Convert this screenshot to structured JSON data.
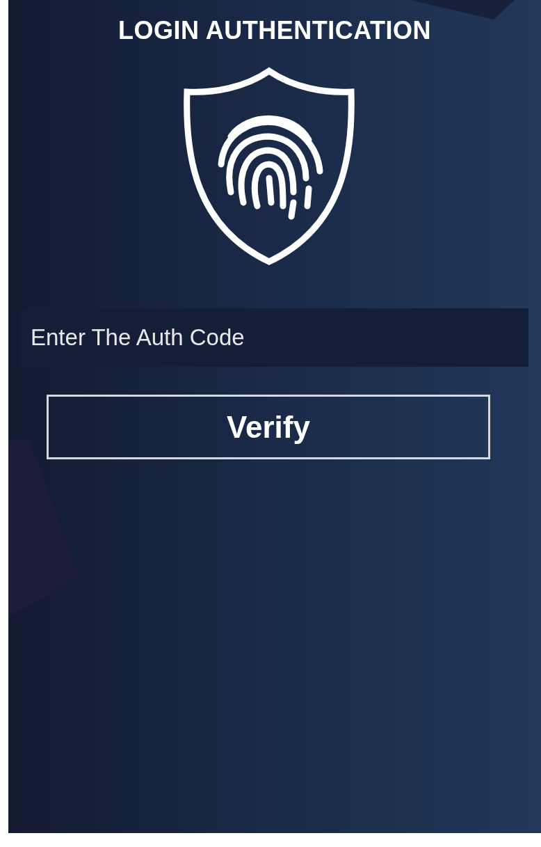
{
  "title": "LOGIN AUTHENTICATION",
  "auth_field": {
    "placeholder": "Enter The Auth Code"
  },
  "verify_button": {
    "label": "Verify"
  }
}
